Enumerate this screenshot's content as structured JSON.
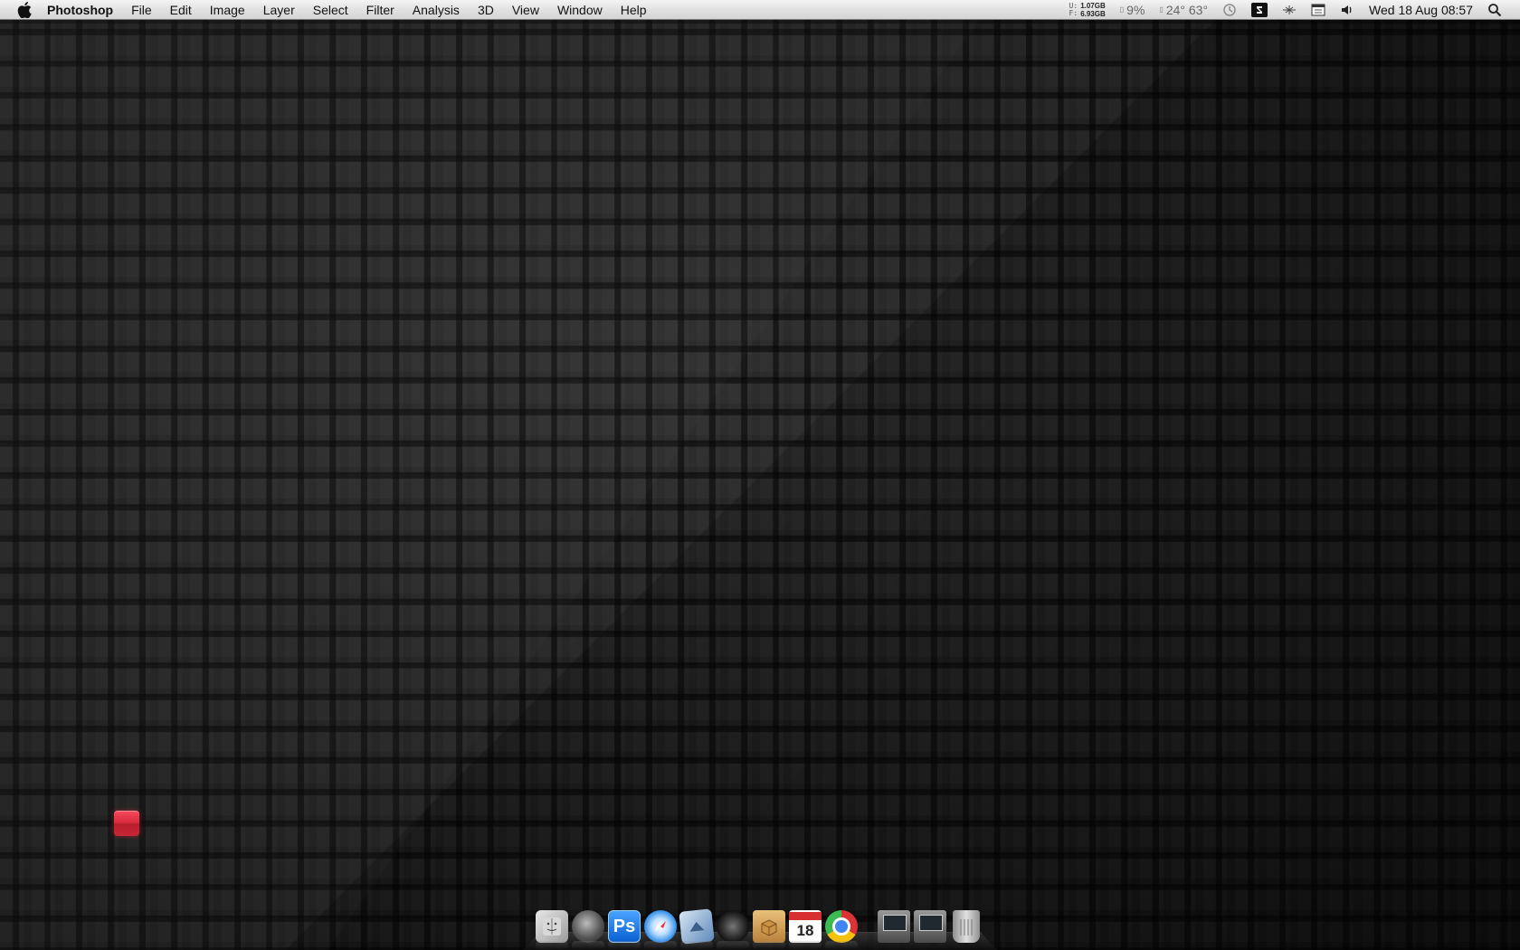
{
  "menubar": {
    "app_name": "Photoshop",
    "menus": [
      "File",
      "Edit",
      "Image",
      "Layer",
      "Select",
      "Filter",
      "Analysis",
      "3D",
      "View",
      "Window",
      "Help"
    ],
    "status": {
      "memory_used_label": "U:",
      "memory_free_label": "F:",
      "memory_used": "1.07GB",
      "memory_free": "6.93GB",
      "cpu": "9%",
      "temps": "24° 63°",
      "clock": "Wed 18 Aug  08:57"
    }
  },
  "dock": {
    "calendar_day": "18",
    "photoshop_label": "Ps"
  },
  "colors": {
    "desktop_bg": "#151515",
    "menubar_bg": "#e2e2e2",
    "red_tile": "#d92a3c"
  },
  "icons": [
    "apple-icon",
    "finder-icon",
    "dashboard-icon",
    "photoshop-icon",
    "safari-icon",
    "mail-icon",
    "speaker-icon",
    "installer-box-icon",
    "calendar-icon",
    "chrome-icon",
    "monitor-icon",
    "monitor-icon",
    "trash-icon",
    "spotlight-icon",
    "time-machine-icon",
    "volume-icon",
    "display-icon",
    "bluetooth-icon"
  ]
}
